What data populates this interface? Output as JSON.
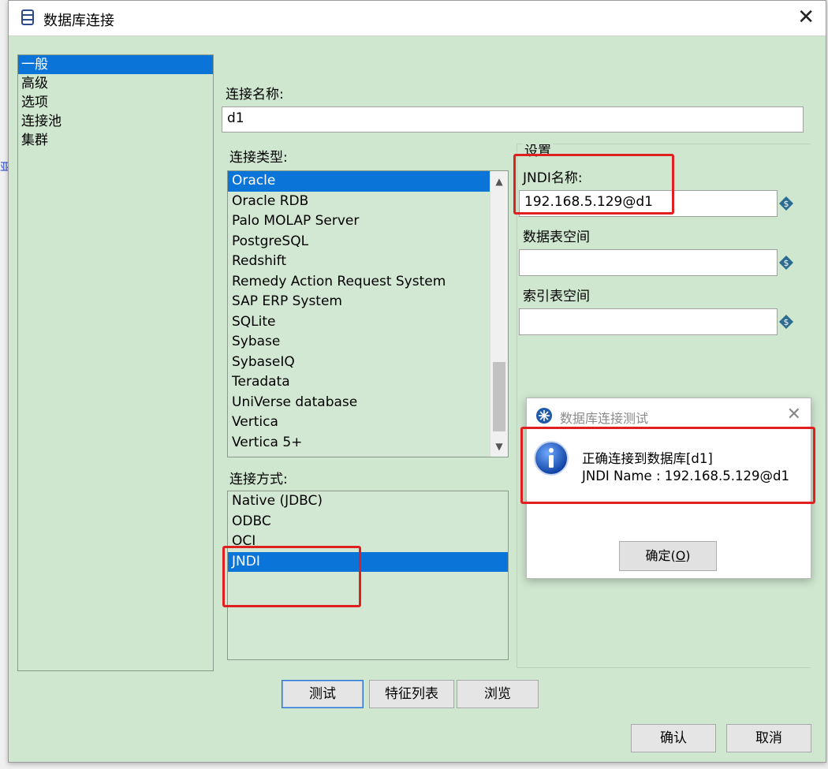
{
  "window": {
    "title": "数据库连接",
    "icon": "database-icon",
    "close_glyph": "✕"
  },
  "edge_fragment": "亚",
  "nav": {
    "items": [
      "一般",
      "高级",
      "选项",
      "连接池",
      "集群"
    ],
    "selected": 0
  },
  "connection_name": {
    "label": "连接名称:",
    "value": "d1"
  },
  "connection_type": {
    "label": "连接类型:",
    "items": [
      "Oracle",
      "Oracle RDB",
      "Palo MOLAP Server",
      "PostgreSQL",
      "Redshift",
      "Remedy Action Request System",
      "SAP ERP System",
      "SQLite",
      "Sybase",
      "SybaseIQ",
      "Teradata",
      "UniVerse database",
      "Vertica",
      "Vertica 5+"
    ],
    "selected": "Oracle"
  },
  "access_method": {
    "label": "连接方式:",
    "items": [
      "Native (JDBC)",
      "ODBC",
      "OCI",
      "JNDI"
    ],
    "selected": "JNDI"
  },
  "settings": {
    "group_label": "设置",
    "jndi_label": "JNDI名称:",
    "jndi_value": "192.168.5.129@d1",
    "data_tablespace_label": "数据表空间",
    "data_tablespace_value": "",
    "index_tablespace_label": "索引表空间",
    "index_tablespace_value": ""
  },
  "buttons": {
    "test": "测试",
    "feature_list": "特征列表",
    "browse": "浏览",
    "ok": "确认",
    "cancel": "取消"
  },
  "test_dialog": {
    "title": "数据库连接测试",
    "close_glyph": "✕",
    "message_line1": "正确连接到数据库[d1]",
    "message_line2": "JNDI Name : 192.168.5.129@d1",
    "ok_label": "确定(",
    "ok_mnemonic": "O",
    "ok_suffix": ")"
  },
  "colors": {
    "selection": "#0a74d8",
    "background": "#cfe6cf",
    "highlight_box": "#e02020"
  }
}
